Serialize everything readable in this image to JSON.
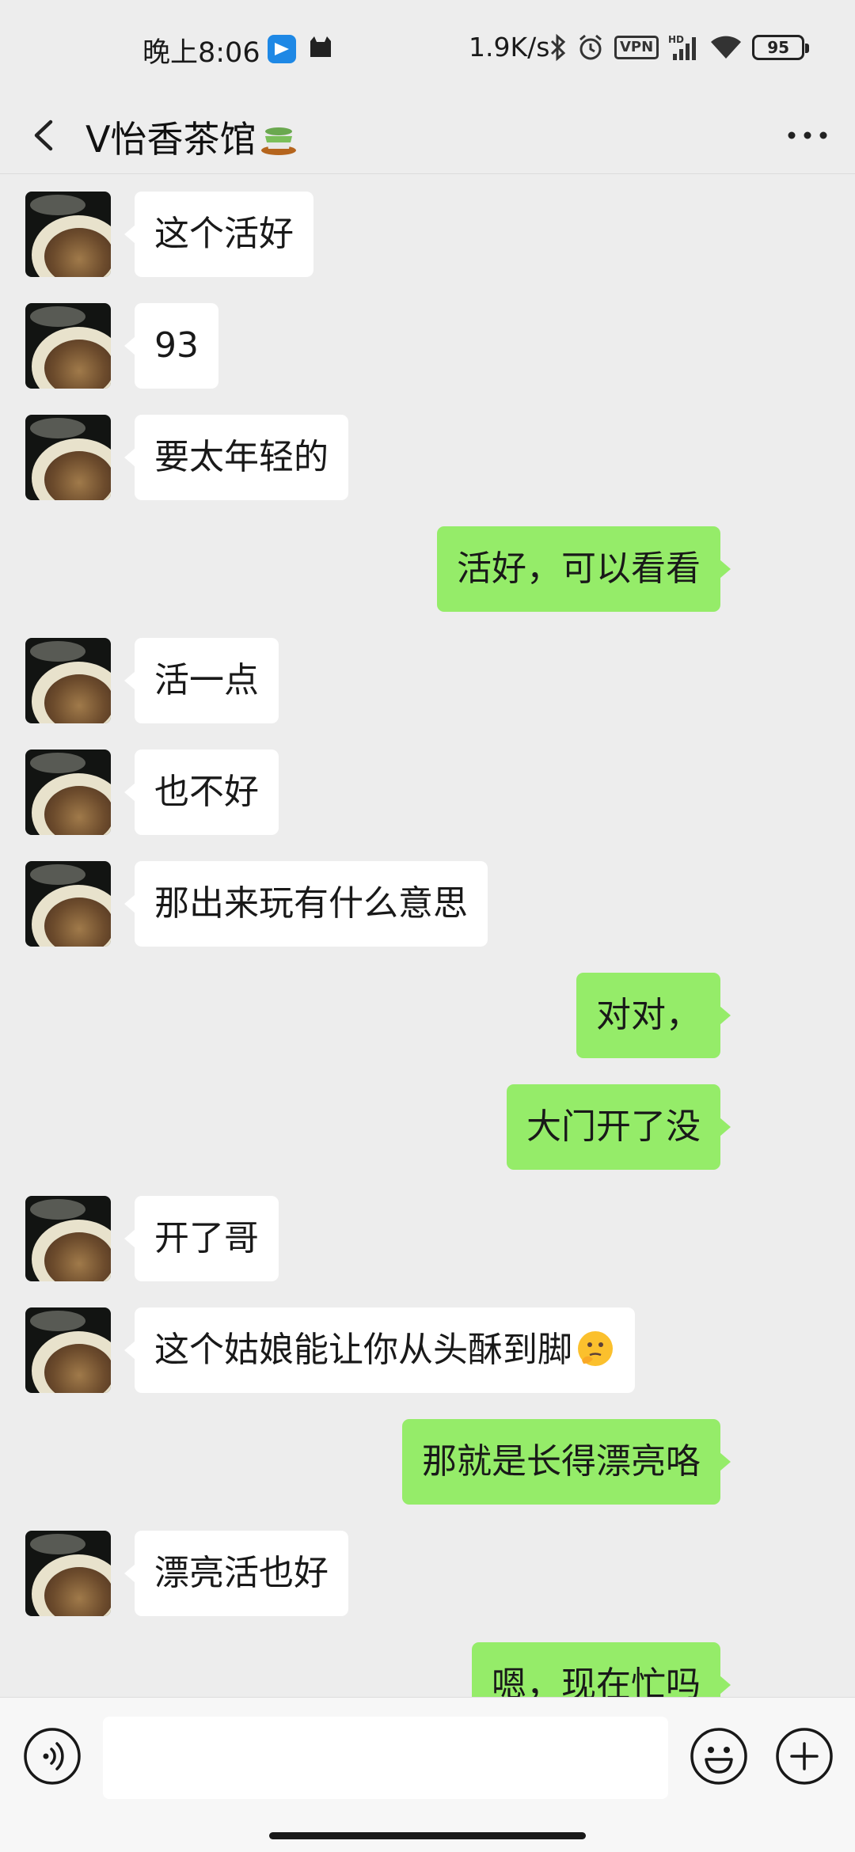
{
  "status_bar": {
    "time": "晚上8:06",
    "net_speed": "1.9K/s",
    "vpn_label": "VPN",
    "battery_level": "95",
    "icons": [
      "bluetooth-icon",
      "alarm-icon",
      "vpn-icon",
      "hd-signal-icon",
      "wifi-icon",
      "battery-icon"
    ]
  },
  "header": {
    "title": "V怡香茶馆",
    "title_emoji": "tea-cup-emoji",
    "back_icon": "chevron-left-icon",
    "more_icon": "more-dots-icon"
  },
  "messages": [
    {
      "side": "in",
      "text": "这个活好"
    },
    {
      "side": "in",
      "text": "93"
    },
    {
      "side": "in",
      "text": "要太年轻的"
    },
    {
      "side": "out",
      "text": "活好，可以看看"
    },
    {
      "side": "in",
      "text": "活一点"
    },
    {
      "side": "in",
      "text": "也不好"
    },
    {
      "side": "in",
      "text": "那出来玩有什么意思"
    },
    {
      "side": "out",
      "text": "对对，"
    },
    {
      "side": "out",
      "text": "大门开了没"
    },
    {
      "side": "in",
      "text": "开了哥"
    },
    {
      "side": "in",
      "text": "这个姑娘能让你从头酥到脚",
      "emoji": "thinking-face-emoji"
    },
    {
      "side": "out",
      "text": "那就是长得漂亮咯"
    },
    {
      "side": "in",
      "text": "漂亮活也好"
    },
    {
      "side": "out",
      "text": "嗯，现在忙吗"
    }
  ],
  "input_bar": {
    "value": "",
    "icons": [
      "voice-icon",
      "emoji-icon",
      "plus-icon"
    ]
  },
  "colors": {
    "background": "#ededed",
    "incoming_bubble": "#ffffff",
    "outgoing_bubble": "#95ec69",
    "text": "#191919"
  }
}
